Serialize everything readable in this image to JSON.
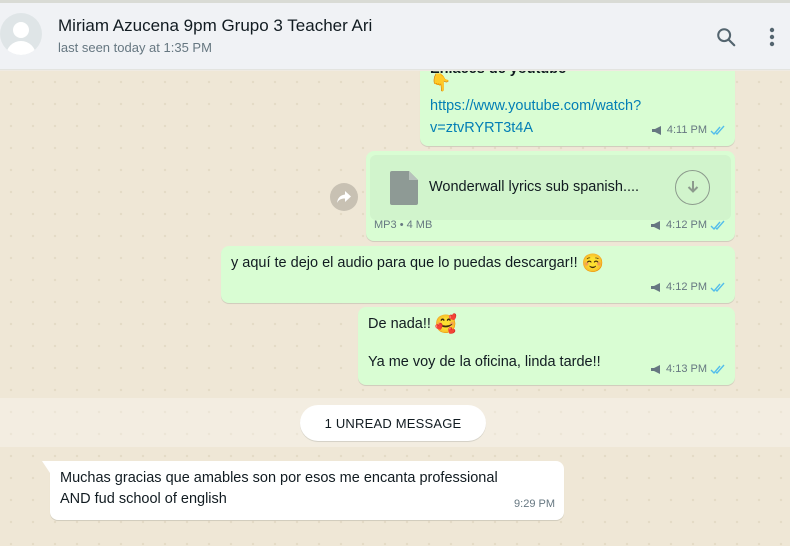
{
  "header": {
    "contact_name": "Miriam Azucena 9pm Grupo 3 Teacher Ari",
    "last_seen": "last seen today at 1:35 PM",
    "icons": [
      "search-icon",
      "menu-dots-icon"
    ]
  },
  "messages": [
    {
      "direction": "outgoing",
      "partial_title": "Enlaces de youtube",
      "pointing_emoji": "👇",
      "link": "https://www.youtube.com/watch?v=ztvRYRT3t4A",
      "time": "4:11 PM",
      "status": "read"
    },
    {
      "direction": "outgoing",
      "type": "document",
      "file_name": "Wonderwall lyrics sub spanish....",
      "file_type": "MP3",
      "separator": "•",
      "file_size": "4 MB",
      "time": "4:12 PM",
      "status": "read"
    },
    {
      "direction": "outgoing",
      "text": "y aquí te dejo el audio para que lo puedas descargar!!",
      "emoji": "☺️",
      "time": "4:12 PM",
      "status": "read"
    },
    {
      "direction": "outgoing",
      "line1": "De nada!!",
      "line1_emoji": "🥰",
      "line2": "Ya me voy de la oficina, linda tarde!!",
      "time": "4:13 PM",
      "status": "read"
    },
    {
      "direction": "incoming",
      "text": "Muchas gracias que amables son por esos me encanta professional AND fud school of english",
      "time": "9:29 PM"
    }
  ],
  "unread_divider": "1 UNREAD MESSAGE",
  "colors": {
    "outgoing_bubble": "#d9fdd3",
    "incoming_bubble": "#ffffff",
    "link": "#027eb5",
    "read_ticks": "#53bdeb"
  }
}
